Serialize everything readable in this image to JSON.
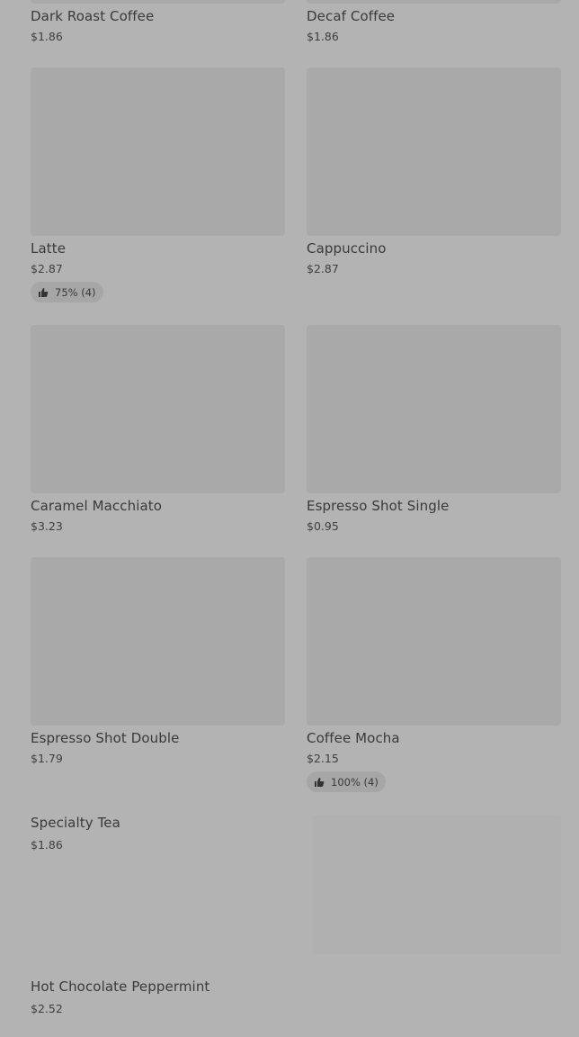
{
  "menu": {
    "items": [
      {
        "name": "Dark Roast Coffee",
        "price": "$1.86"
      },
      {
        "name": "Decaf Coffee",
        "price": "$1.86"
      },
      {
        "name": "Latte",
        "price": "$2.87",
        "rating": "75% (4)"
      },
      {
        "name": "Cappuccino",
        "price": "$2.87"
      },
      {
        "name": "Caramel Macchiato",
        "price": "$3.23"
      },
      {
        "name": "Espresso Shot Single",
        "price": "$0.95"
      },
      {
        "name": "Espresso Shot Double",
        "price": "$1.79"
      },
      {
        "name": "Coffee Mocha",
        "price": "$2.15",
        "rating": "100% (4)"
      },
      {
        "name": "Specialty Tea",
        "price": "$1.86"
      },
      {
        "name": "Hot Chocolate Peppermint",
        "price": "$2.52"
      }
    ]
  },
  "icons": {
    "rating": "thumbs-up-icon"
  },
  "colors": {
    "background": "#b3b3b3",
    "image_placeholder": "#a9a9a9",
    "badge": "#a6a6a6"
  }
}
